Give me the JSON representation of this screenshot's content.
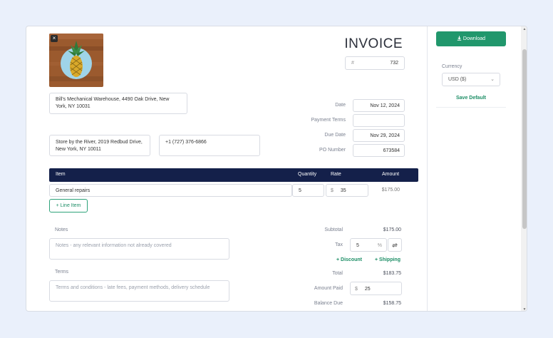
{
  "invoice": {
    "title": "INVOICE",
    "number_prefix": "#",
    "number": "732",
    "from": "Bill's Mechanical Warehouse, 4490 Oak Drive, New York, NY 10031",
    "bill_to": "Store by the River, 2019 Redbud Drive, New York, NY 10011",
    "ship_to": "+1 (727) 376-6866",
    "date_label": "Date",
    "date": "Nov 12, 2024",
    "payment_terms_label": "Payment Terms",
    "payment_terms": "",
    "due_date_label": "Due Date",
    "due_date": "Nov 29, 2024",
    "po_label": "PO Number",
    "po_number": "673584"
  },
  "table": {
    "headers": {
      "item": "Item",
      "quantity": "Quantity",
      "rate": "Rate",
      "amount": "Amount"
    },
    "rows": [
      {
        "item": "General repairs",
        "quantity": "5",
        "rate_symbol": "$",
        "rate": "35",
        "amount": "$175.00"
      }
    ],
    "add_line_label": "+ Line Item"
  },
  "notes": {
    "label": "Notes",
    "placeholder": "Notes - any relevant information not already covered"
  },
  "terms": {
    "label": "Terms",
    "placeholder": "Terms and conditions - late fees, payment methods, delivery schedule"
  },
  "totals": {
    "subtotal_label": "Subtotal",
    "subtotal": "$175.00",
    "tax_label": "Tax",
    "tax": "5",
    "tax_unit": "%",
    "discount_label": "+ Discount",
    "shipping_label": "+ Shipping",
    "total_label": "Total",
    "total": "$183.75",
    "amount_paid_label": "Amount Paid",
    "amount_paid_symbol": "$",
    "amount_paid": "25",
    "balance_due_label": "Balance Due",
    "balance_due": "$158.75"
  },
  "sidebar": {
    "download_label": "Download",
    "currency_label": "Currency",
    "currency_value": "USD ($)",
    "save_default_label": "Save Default"
  },
  "colors": {
    "accent": "#21976c",
    "header": "#14204a",
    "background": "#eaf0fb"
  },
  "icons": [
    "close-icon",
    "download-icon",
    "chevron-down-icon",
    "swap-icon",
    "pineapple-logo"
  ]
}
